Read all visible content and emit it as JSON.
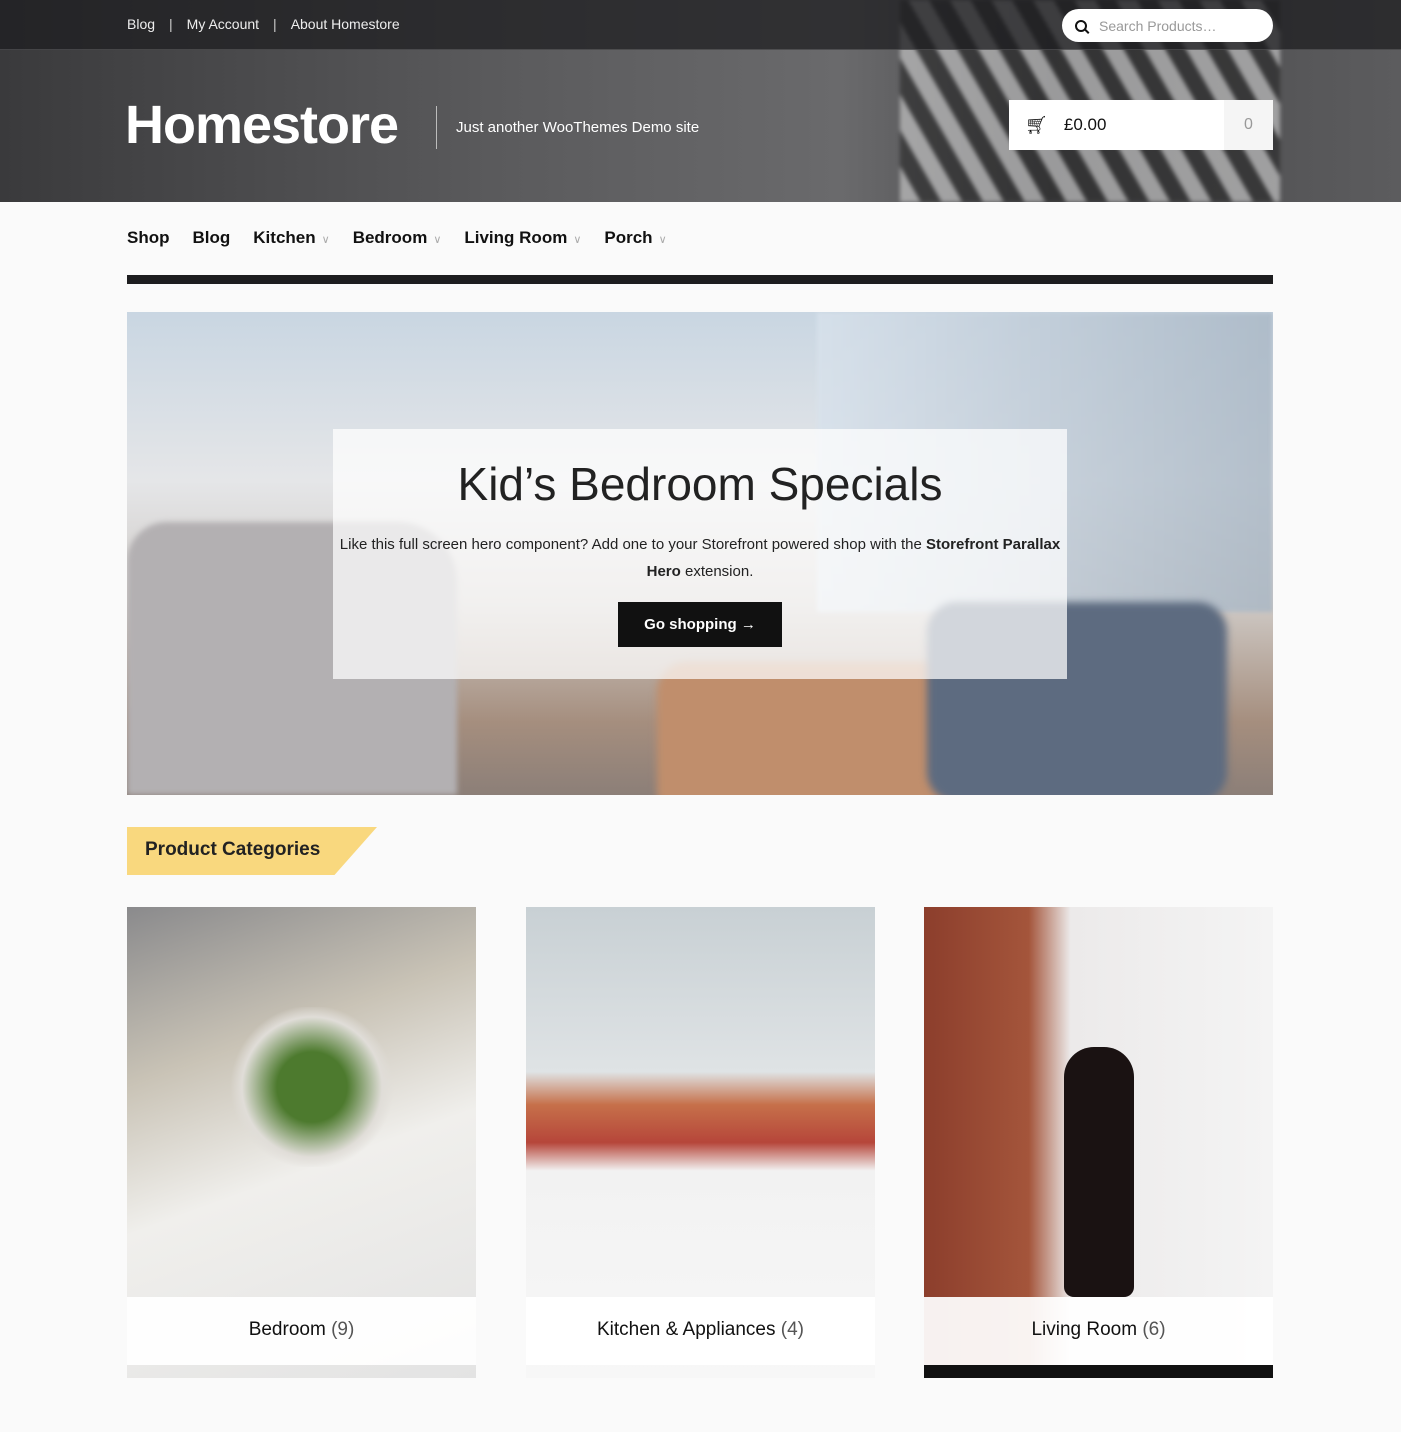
{
  "topbar": {
    "links": [
      "Blog",
      "My Account",
      "About Homestore"
    ],
    "search_placeholder": "Search Products…"
  },
  "site": {
    "title": "Homestore",
    "tagline": "Just another WooThemes Demo site"
  },
  "cart": {
    "amount": "£0.00",
    "count": "0"
  },
  "nav": [
    {
      "label": "Shop"
    },
    {
      "label": "Blog"
    },
    {
      "label": "Kitchen",
      "dropdown": true
    },
    {
      "label": "Bedroom",
      "dropdown": true
    },
    {
      "label": "Living Room",
      "dropdown": true
    },
    {
      "label": "Porch",
      "dropdown": true
    }
  ],
  "hero": {
    "title": "Kid’s Bedroom Specials",
    "text_1": "Like this full screen hero component? Add one to your Storefront powered shop with the",
    "text_bold": "Storefront Parallax Hero",
    "text_2": "extension.",
    "button": "Go shopping →"
  },
  "categories": {
    "heading": "Product Categories",
    "items": [
      {
        "name": "Bedroom",
        "count": "(9)"
      },
      {
        "name": "Kitchen & Appliances",
        "count": "(4)"
      },
      {
        "name": "Living Room",
        "count": "(6)"
      }
    ]
  },
  "colors": {
    "accent": "#f9d87e",
    "dark": "#1d1d1f"
  }
}
